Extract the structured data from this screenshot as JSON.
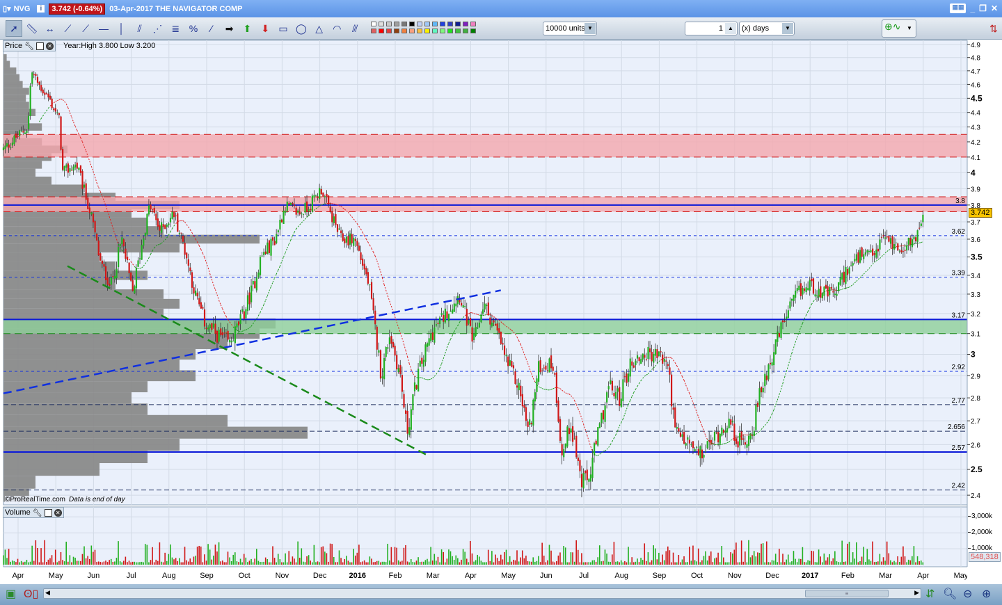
{
  "title": {
    "symbol": "NVG",
    "price_change": "3.742 (-0.64%)",
    "date_name": "03-Apr-2017 THE NAVIGATOR COMP"
  },
  "toolbar": {
    "tools": [
      "pointer",
      "ruler",
      "horizontal-segment",
      "line",
      "segment",
      "horizontal-line",
      "vertical-line",
      "channel",
      "fan-lines",
      "fibonacci",
      "percentage",
      "points",
      "arrow-right",
      "arrow-up",
      "arrow-down",
      "rectangle",
      "ellipse",
      "triangle",
      "arcs",
      "gann-lines"
    ],
    "palette": [
      "#ffffff",
      "#e0e0e0",
      "#c8c8c8",
      "#a0a0a0",
      "#787878",
      "#000000",
      "#c0d0f8",
      "#a0c8f8",
      "#60b8f8",
      "#2040e0",
      "#3040c0",
      "#102090",
      "#8020c0",
      "#f080c0",
      "#e06060",
      "#ff0000",
      "#e04040",
      "#904010",
      "#f08040",
      "#f8a080",
      "#f8c040",
      "#f8f000",
      "#60f8c0",
      "#80f880",
      "#20e020",
      "#40c040",
      "#40b040",
      "#008000"
    ],
    "units_value": "10000 units",
    "period_value": "1",
    "period_unit": "(x) days"
  },
  "price_pane": {
    "label": "Price",
    "info": "Year:High 3.800 Low 3.200",
    "copyright": "©ProRealTime.com",
    "end_note": "Data is end of day",
    "last_price": "3.742"
  },
  "volume_pane": {
    "label": "Volume",
    "last_volume": "548,318",
    "ticks": [
      {
        "v": 3000,
        "label": "3,000k"
      },
      {
        "v": 2000,
        "label": "2,000k"
      },
      {
        "v": 1000,
        "label": "1,000k"
      }
    ]
  },
  "colors": {
    "up": "#22b022",
    "down": "#d01818",
    "resistance_zone": "#f4a8ae",
    "support_zone": "#8fcf9a",
    "level_line": "#0a18d8"
  },
  "chart_data": {
    "type": "candlestick",
    "x_unit": "months since Apr-2015",
    "price_scale": "log",
    "ylim": [
      2.4,
      4.9
    ],
    "price_ticks": [
      {
        "v": 4.9,
        "l": "4.9"
      },
      {
        "v": 4.8,
        "l": "4.8"
      },
      {
        "v": 4.7,
        "l": "4.7"
      },
      {
        "v": 4.6,
        "l": "4.6"
      },
      {
        "v": 4.5,
        "l": "4.5",
        "b": 1
      },
      {
        "v": 4.4,
        "l": "4.4"
      },
      {
        "v": 4.3,
        "l": "4.3"
      },
      {
        "v": 4.2,
        "l": "4.2"
      },
      {
        "v": 4.1,
        "l": "4.1"
      },
      {
        "v": 4.0,
        "l": "4",
        "b": 1
      },
      {
        "v": 3.9,
        "l": "3.9"
      },
      {
        "v": 3.8,
        "l": "3.8"
      },
      {
        "v": 3.7,
        "l": "3.7"
      },
      {
        "v": 3.6,
        "l": "3.6"
      },
      {
        "v": 3.5,
        "l": "3.5",
        "b": 1
      },
      {
        "v": 3.4,
        "l": "3.4"
      },
      {
        "v": 3.3,
        "l": "3.3"
      },
      {
        "v": 3.2,
        "l": "3.2"
      },
      {
        "v": 3.1,
        "l": "3.1"
      },
      {
        "v": 3.0,
        "l": "3",
        "b": 1
      },
      {
        "v": 2.9,
        "l": "2.9"
      },
      {
        "v": 2.8,
        "l": "2.8"
      },
      {
        "v": 2.7,
        "l": "2.7"
      },
      {
        "v": 2.6,
        "l": "2.6"
      },
      {
        "v": 2.5,
        "l": "2.5",
        "b": 1
      },
      {
        "v": 2.4,
        "l": "2.4"
      }
    ],
    "months": [
      {
        "l": "Apr"
      },
      {
        "l": "May"
      },
      {
        "l": "Jun"
      },
      {
        "l": "Jul"
      },
      {
        "l": "Aug"
      },
      {
        "l": "Sep"
      },
      {
        "l": "Oct"
      },
      {
        "l": "Nov"
      },
      {
        "l": "Dec"
      },
      {
        "l": "2016",
        "b": 1
      },
      {
        "l": "Feb"
      },
      {
        "l": "Mar"
      },
      {
        "l": "Apr"
      },
      {
        "l": "May"
      },
      {
        "l": "Jun"
      },
      {
        "l": "Jul"
      },
      {
        "l": "Aug"
      },
      {
        "l": "Sep"
      },
      {
        "l": "Oct"
      },
      {
        "l": "Nov"
      },
      {
        "l": "Dec"
      },
      {
        "l": "2017",
        "b": 1
      },
      {
        "l": "Feb"
      },
      {
        "l": "Mar"
      },
      {
        "l": "Apr"
      },
      {
        "l": "May"
      }
    ],
    "price_path": [
      [
        -0.39,
        4.15
      ],
      [
        0.26,
        4.3
      ],
      [
        0.35,
        4.7
      ],
      [
        0.54,
        4.6
      ],
      [
        0.81,
        4.5
      ],
      [
        1.09,
        4.35
      ],
      [
        1.18,
        4.0
      ],
      [
        1.55,
        4.05
      ],
      [
        1.92,
        3.75
      ],
      [
        2.2,
        3.45
      ],
      [
        2.47,
        3.35
      ],
      [
        2.75,
        3.6
      ],
      [
        3.03,
        3.3
      ],
      [
        3.49,
        3.8
      ],
      [
        3.76,
        3.65
      ],
      [
        4.13,
        3.75
      ],
      [
        4.41,
        3.55
      ],
      [
        4.69,
        3.3
      ],
      [
        4.96,
        3.15
      ],
      [
        5.24,
        3.1
      ],
      [
        5.61,
        3.05
      ],
      [
        5.98,
        3.2
      ],
      [
        6.25,
        3.35
      ],
      [
        6.44,
        3.5
      ],
      [
        6.81,
        3.6
      ],
      [
        7.08,
        3.8
      ],
      [
        7.45,
        3.75
      ],
      [
        7.73,
        3.8
      ],
      [
        8.04,
        3.9
      ],
      [
        8.28,
        3.75
      ],
      [
        8.56,
        3.6
      ],
      [
        8.93,
        3.6
      ],
      [
        9.3,
        3.35
      ],
      [
        9.48,
        3.1
      ],
      [
        9.63,
        2.9
      ],
      [
        9.85,
        3.1
      ],
      [
        10.13,
        2.9
      ],
      [
        10.31,
        2.65
      ],
      [
        10.59,
        2.9
      ],
      [
        10.96,
        3.1
      ],
      [
        11.33,
        3.2
      ],
      [
        11.7,
        3.3
      ],
      [
        12.07,
        3.05
      ],
      [
        12.34,
        3.25
      ],
      [
        12.71,
        3.1
      ],
      [
        12.99,
        2.95
      ],
      [
        13.27,
        2.85
      ],
      [
        13.54,
        2.65
      ],
      [
        13.82,
        2.95
      ],
      [
        14.19,
        2.95
      ],
      [
        14.43,
        2.55
      ],
      [
        14.65,
        2.7
      ],
      [
        14.93,
        2.45
      ],
      [
        15.11,
        2.45
      ],
      [
        15.39,
        2.65
      ],
      [
        15.66,
        2.85
      ],
      [
        15.94,
        2.8
      ],
      [
        16.22,
        2.95
      ],
      [
        16.59,
        3.0
      ],
      [
        16.96,
        3.0
      ],
      [
        17.23,
        2.95
      ],
      [
        17.42,
        2.65
      ],
      [
        17.79,
        2.6
      ],
      [
        18.06,
        2.55
      ],
      [
        18.34,
        2.6
      ],
      [
        18.8,
        2.7
      ],
      [
        19.17,
        2.6
      ],
      [
        19.45,
        2.65
      ],
      [
        19.72,
        2.85
      ],
      [
        20.0,
        3.0
      ],
      [
        20.28,
        3.15
      ],
      [
        20.65,
        3.3
      ],
      [
        21.01,
        3.35
      ],
      [
        21.38,
        3.3
      ],
      [
        21.66,
        3.3
      ],
      [
        21.94,
        3.42
      ],
      [
        22.31,
        3.5
      ],
      [
        22.68,
        3.5
      ],
      [
        22.95,
        3.62
      ],
      [
        23.32,
        3.55
      ],
      [
        23.69,
        3.58
      ],
      [
        23.87,
        3.65
      ],
      [
        24.02,
        3.742
      ]
    ],
    "zones": [
      {
        "from": 4.1,
        "to": 4.25,
        "kind": "resistance"
      },
      {
        "from": 3.76,
        "to": 3.85,
        "kind": "resistance"
      },
      {
        "from": 3.1,
        "to": 3.17,
        "kind": "support"
      }
    ],
    "levels": [
      {
        "v": 3.8,
        "l": "3.8",
        "style": "solid"
      },
      {
        "v": 3.62,
        "l": "3.62",
        "style": "blue-dash"
      },
      {
        "v": 3.39,
        "l": "3.39",
        "style": "blue-dash"
      },
      {
        "v": 3.17,
        "l": "3.17",
        "style": "solid"
      },
      {
        "v": 2.92,
        "l": "2.92",
        "style": "blue-dash"
      },
      {
        "v": 2.77,
        "l": "2.77",
        "style": "dark-dash"
      },
      {
        "v": 2.656,
        "l": "2.656",
        "style": "dark-dash"
      },
      {
        "v": 2.57,
        "l": "2.57",
        "style": "solid"
      },
      {
        "v": 2.42,
        "l": "2.42",
        "style": "dark-dash"
      }
    ],
    "trendlines": [
      {
        "from": [
          -0.39,
          2.82
        ],
        "to": [
          12.8,
          3.32
        ],
        "color": "#1030e0"
      },
      {
        "from": [
          1.31,
          3.45
        ],
        "to": [
          10.81,
          2.56
        ],
        "color": "#1a8a1a"
      }
    ],
    "volume_profile": [
      [
        2.4,
        0.08
      ],
      [
        2.45,
        0.1
      ],
      [
        2.5,
        0.3
      ],
      [
        2.55,
        0.45
      ],
      [
        2.6,
        0.55
      ],
      [
        2.65,
        0.95
      ],
      [
        2.7,
        0.7
      ],
      [
        2.75,
        0.45
      ],
      [
        2.8,
        0.4
      ],
      [
        2.85,
        0.45
      ],
      [
        2.9,
        0.6
      ],
      [
        2.95,
        0.55
      ],
      [
        3.0,
        0.6
      ],
      [
        3.05,
        0.7
      ],
      [
        3.1,
        0.8
      ],
      [
        3.15,
        0.85
      ],
      [
        3.2,
        0.5
      ],
      [
        3.25,
        0.55
      ],
      [
        3.3,
        0.5
      ],
      [
        3.35,
        0.35
      ],
      [
        3.4,
        0.45
      ],
      [
        3.45,
        0.35
      ],
      [
        3.5,
        0.3
      ],
      [
        3.55,
        0.55
      ],
      [
        3.6,
        0.8
      ],
      [
        3.65,
        0.5
      ],
      [
        3.7,
        0.45
      ],
      [
        3.75,
        0.4
      ],
      [
        3.8,
        0.55
      ],
      [
        3.85,
        0.35
      ],
      [
        3.9,
        0.25
      ],
      [
        3.95,
        0.15
      ],
      [
        4.0,
        0.1
      ],
      [
        4.05,
        0.12
      ],
      [
        4.1,
        0.15
      ],
      [
        4.15,
        0.2
      ],
      [
        4.2,
        0.12
      ],
      [
        4.25,
        0.05
      ],
      [
        4.3,
        0.12
      ],
      [
        4.35,
        0.08
      ],
      [
        4.4,
        0.1
      ],
      [
        4.45,
        0.08
      ],
      [
        4.5,
        0.07
      ],
      [
        4.55,
        0.08
      ],
      [
        4.6,
        0.06
      ],
      [
        4.65,
        0.05
      ],
      [
        4.7,
        0.04
      ],
      [
        4.75,
        0.02
      ],
      [
        4.8,
        0.01
      ]
    ],
    "moving_average_period": 20
  }
}
